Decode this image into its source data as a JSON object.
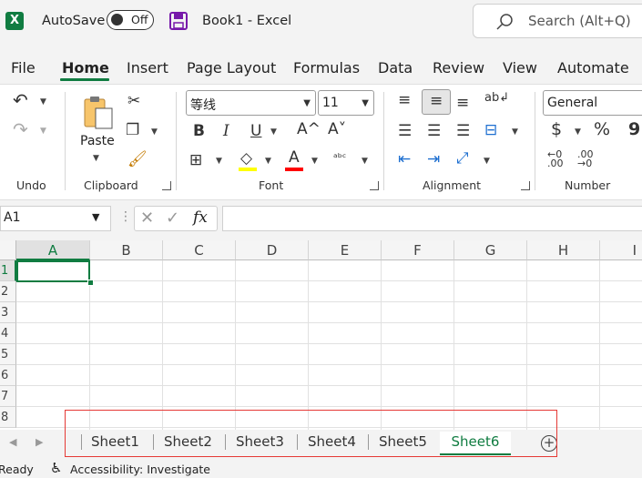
{
  "titlebar": {
    "logo": "X",
    "autosave_label": "AutoSave",
    "autosave_state": "Off",
    "doc_title": "Book1  -  Excel",
    "search_placeholder": "Search (Alt+Q)"
  },
  "menu": {
    "tabs": [
      "File",
      "Home",
      "Insert",
      "Page Layout",
      "Formulas",
      "Data",
      "Review",
      "View",
      "Automate"
    ],
    "active": "Home"
  },
  "ribbon": {
    "groups": {
      "undo": "Undo",
      "clipboard": "Clipboard",
      "font": "Font",
      "alignment": "Alignment",
      "number": "Number"
    },
    "paste_label": "Paste",
    "font_name": "等线",
    "font_size": "11",
    "number_format": "General",
    "bold": "B",
    "italic": "I",
    "underline": "U",
    "grow_font": "A^",
    "shrink_font": "A˅",
    "font_color_letter": "A",
    "currency": "$",
    "percent": "%",
    "comma": "9",
    "colors": {
      "highlight": "#ffff00",
      "font_color": "#ff0000",
      "accent": "#107c41"
    }
  },
  "formula_bar": {
    "name_box": "A1",
    "fx": "fx",
    "value": ""
  },
  "grid": {
    "columns": [
      "A",
      "B",
      "C",
      "D",
      "E",
      "F",
      "G",
      "H",
      "I"
    ],
    "rows": [
      "1",
      "2",
      "3",
      "4",
      "5",
      "6",
      "7",
      "8"
    ],
    "active_cell": "A1"
  },
  "sheets": {
    "tabs": [
      "Sheet1",
      "Sheet2",
      "Sheet3",
      "Sheet4",
      "Sheet5",
      "Sheet6"
    ],
    "active": "Sheet6",
    "add": "+"
  },
  "status": {
    "ready": "Ready",
    "accessibility": "Accessibility: Investigate"
  }
}
